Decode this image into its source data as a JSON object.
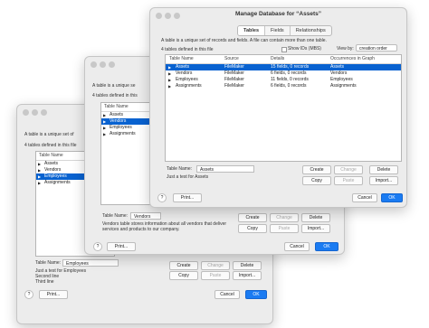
{
  "w3": {
    "description": "A table is a unique set of",
    "count": "4 tables defined in this file",
    "header": "Table Name",
    "rows": [
      "Assets",
      "Vendors",
      "Employees",
      "Assignments"
    ],
    "table_name_label": "Table Name:",
    "table_name_value": "Employees",
    "comment_lines": [
      "Just a test for Employees",
      "Second line",
      "Third line"
    ],
    "buttons": {
      "create": "Create",
      "change": "Change",
      "delete": "Delete",
      "copy": "Copy",
      "paste": "Paste",
      "import": "Import...",
      "print": "Print...",
      "cancel": "Cancel",
      "ok": "OK",
      "help": "?"
    }
  },
  "w2": {
    "description": "A table is a unique se",
    "count": "4 tables defined in this",
    "header": "Table Name",
    "rows": [
      "Assets",
      "Vendors",
      "Employees",
      "Assignments"
    ],
    "table_name_label": "Table Name:",
    "table_name_value": "Vendors",
    "comment_lines": [
      "Vendors table stores information about all vendors that deliver",
      "services and products to our company."
    ],
    "buttons": {
      "create": "Create",
      "change": "Change",
      "delete": "Delete",
      "copy": "Copy",
      "paste": "Paste",
      "import": "Import...",
      "print": "Print...",
      "cancel": "Cancel",
      "ok": "OK",
      "help": "?"
    }
  },
  "w1": {
    "title": "Manage Database for “Assets”",
    "tabs": [
      "Tables",
      "Fields",
      "Relationships"
    ],
    "description": "A table is a unique set of records and fields. A file can contain more than one table.",
    "count": "4 tables defined in this file",
    "show_ids": "Show IDs (MBS)",
    "view_by_label": "View by:",
    "view_by_value": "creation order",
    "columns": [
      "Table Name",
      "Source",
      "Details",
      "Occurrences in Graph"
    ],
    "rows": [
      {
        "name": "Assets",
        "source": "FileMaker",
        "details": "15 fields, 0 records",
        "occ": "Assets"
      },
      {
        "name": "Vendors",
        "source": "FileMaker",
        "details": "6 fields, 0 records",
        "occ": "Vendors"
      },
      {
        "name": "Employees",
        "source": "FileMaker",
        "details": "11 fields, 0 records",
        "occ": "Employees"
      },
      {
        "name": "Assignments",
        "source": "FileMaker",
        "details": "6 fields, 0 records",
        "occ": "Assignments"
      }
    ],
    "table_name_label": "Table Name:",
    "table_name_value": "Assets",
    "comment": "Just a test for Assets",
    "buttons": {
      "create": "Create",
      "change": "Change",
      "delete": "Delete",
      "copy": "Copy",
      "paste": "Paste",
      "import": "Import...",
      "print": "Print...",
      "cancel": "Cancel",
      "ok": "OK",
      "help": "?"
    }
  }
}
